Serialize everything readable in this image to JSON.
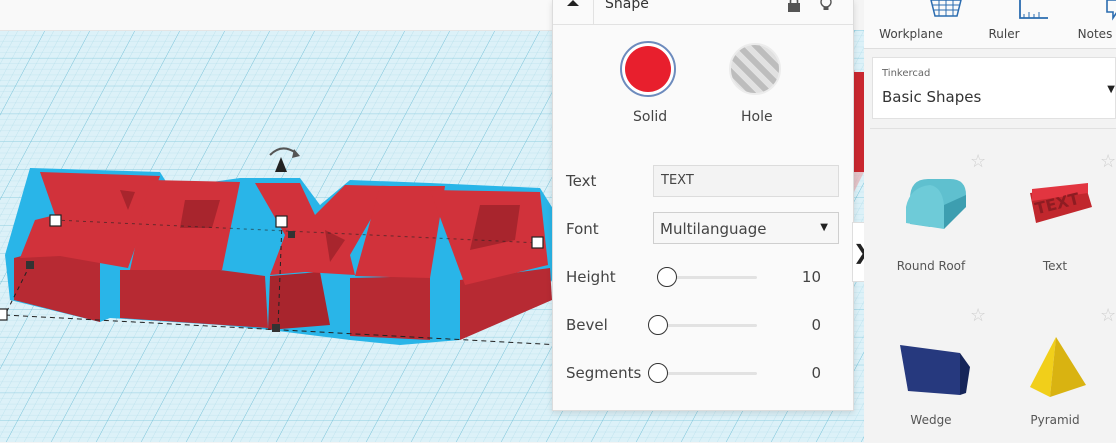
{
  "inspector": {
    "title": "Shape",
    "solid_label": "Solid",
    "hole_label": "Hole",
    "solid_color": "#e81f2d",
    "properties": {
      "text": {
        "label": "Text",
        "value": "TEXT"
      },
      "font": {
        "label": "Font",
        "value": "Multilanguage"
      },
      "height": {
        "label": "Height",
        "value": "10"
      },
      "bevel": {
        "label": "Bevel",
        "value": "0"
      },
      "segments": {
        "label": "Segments",
        "value": "0"
      }
    }
  },
  "toolbar": {
    "workplane_label": "Workplane",
    "ruler_label": "Ruler",
    "notes_label": "Notes"
  },
  "library": {
    "category": "Tinkercad",
    "name": "Basic Shapes",
    "shapes": [
      {
        "label": "Round Roof",
        "icon": "round-roof-icon"
      },
      {
        "label": "Text",
        "icon": "text-shape-icon"
      },
      {
        "label": "Wedge",
        "icon": "wedge-icon"
      },
      {
        "label": "Pyramid",
        "icon": "pyramid-icon"
      }
    ]
  },
  "scene": {
    "text_object": "TEXT",
    "object_color": "#d1323b",
    "outline_color": "#29b5e8"
  },
  "colors": {
    "grid_line": "#9fd6e6",
    "grid_bg": "#d9f0f7",
    "panel_bg": "#fafafa"
  }
}
